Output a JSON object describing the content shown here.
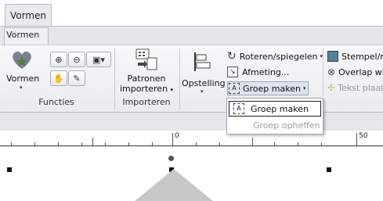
{
  "tabs": {
    "active": "Vormen",
    "sub": "Vormen"
  },
  "ribbon": {
    "groups": {
      "functies": {
        "label": "Functies",
        "vormen_label": "Vormen"
      },
      "importeren": {
        "label": "Importeren",
        "patronen_label": "Patronen",
        "importeren_label": "importeren"
      },
      "opstelling": {
        "label": "Opstelling"
      }
    },
    "buttons": {
      "roteren": "Roteren/spiegelen",
      "afmeting": "Afmeting...",
      "groep_maken": "Groep maken",
      "stempel": "Stempel/re",
      "overlap": "Overlap wi",
      "tekst_plaat": "Tekst plaat"
    }
  },
  "menu": {
    "item1": "Groep maken",
    "item2": "Groep opheffen"
  },
  "ruler": {
    "label0": "0",
    "label50": "50"
  },
  "colors": {
    "heart": "#7b8190",
    "accent": "#1b5fb8",
    "triangle": "#c8c8c8"
  }
}
